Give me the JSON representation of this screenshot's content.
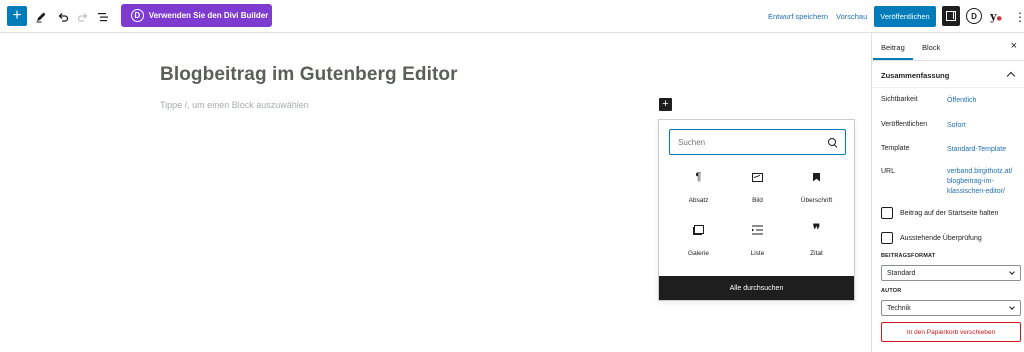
{
  "toolbar": {
    "add_icon": "plus-icon",
    "tools_icon": "pencil-icon",
    "undo_icon": "undo-icon",
    "redo_icon": "redo-icon",
    "outline_icon": "list-view-icon",
    "divi_logo": "D",
    "divi_label": "Verwenden Sie den Divi Builder",
    "save_draft_label": "Entwurf speichern",
    "preview_label": "Vorschau",
    "publish_label": "Veröffentlichen",
    "d_logo": "D",
    "yoast_logo": "y",
    "more_icon": "⋮",
    "accent_color": "#007cba",
    "divi_color": "#7e3bd0"
  },
  "editor": {
    "title": "Blogbeitrag im Gutenberg Editor",
    "block_hint": "Tippe /, um einen Block auszuwählen"
  },
  "inserter": {
    "search_placeholder": "Suchen",
    "blocks": [
      {
        "label": "Absatz",
        "icon": "paragraph-icon"
      },
      {
        "label": "Bild",
        "icon": "image-icon"
      },
      {
        "label": "Überschrift",
        "icon": "heading-icon"
      },
      {
        "label": "Galerie",
        "icon": "gallery-icon"
      },
      {
        "label": "Liste",
        "icon": "list-icon"
      },
      {
        "label": "Zitat",
        "icon": "quote-icon"
      }
    ],
    "browse_all_label": "Alle durchsuchen"
  },
  "sidebar": {
    "tabs": [
      {
        "label": "Beitrag"
      },
      {
        "label": "Block"
      }
    ],
    "close_icon": "×",
    "panel_title": "Zusammenfassung",
    "rows": [
      {
        "label": "Sichtbarkeit",
        "value": "Öffentlich"
      },
      {
        "label": "Veröffentlichen",
        "value": "Sofort"
      },
      {
        "label": "Template",
        "value": "Standard-Template"
      },
      {
        "label": "URL",
        "value_lines": [
          "verband.birgithotz.at/",
          "blogbeitrag-im-",
          "klassischen-editor/"
        ]
      }
    ],
    "sticky_label": "Beitrag auf der Startseite halten",
    "pending_label": "Ausstehende Überprüfung",
    "format_label": "BEITRAGSFORMAT",
    "format_value": "Standard",
    "author_label": "AUTOR",
    "author_value": "Technik",
    "trash_label": "In den Papierkorb verschieben"
  }
}
